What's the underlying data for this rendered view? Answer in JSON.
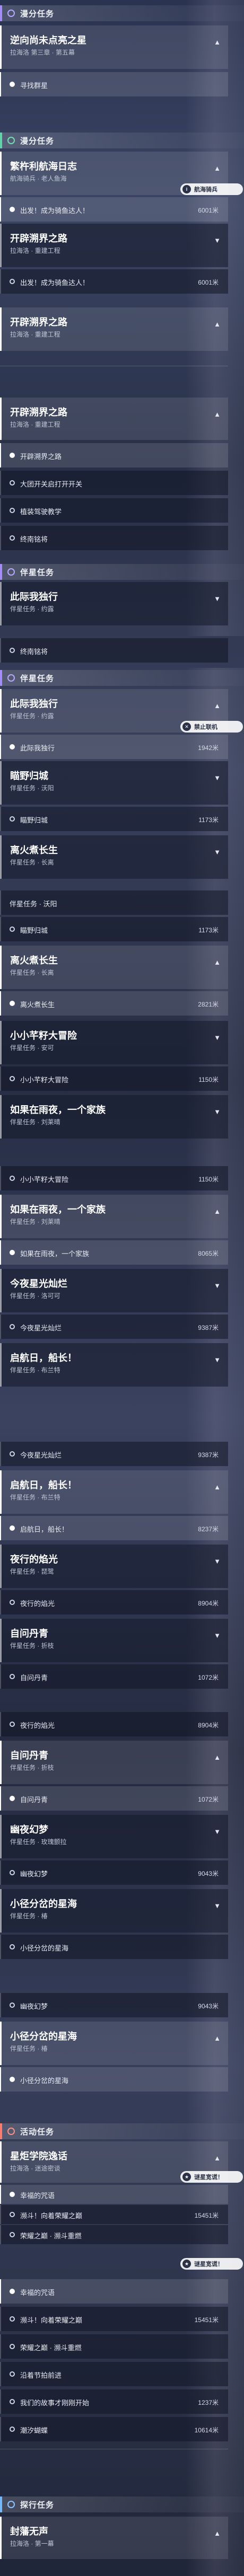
{
  "s1": {
    "cat_title": "漫分任务",
    "card_title": "逆向尚未点亮之星",
    "card_sub": "拉海洛 第三章 · 第五幕",
    "step_label": "寻找群星"
  },
  "s2": {
    "cat_title": "漫分任务",
    "card1_title": "繁杵利航海日志",
    "card1_sub": "航海骑兵 · 老人鱼海",
    "tooltip": "航海骑兵",
    "step1_label": "出发！成为骑鱼达人！",
    "step1_dist": "6001米",
    "card2_title": "开辟溯界之路",
    "card2_sub": "拉海洛 · 重建工程",
    "step2_label": "出发！成为骑鱼达人！",
    "step2_dist": "6001米",
    "card3_title": "开辟溯界之路",
    "card3_sub": "拉海洛 · 重建工程"
  },
  "s3": {
    "card_title": "开辟溯界之路",
    "card_sub": "拉海洛 · 重建工程",
    "step1_label": "开辟溯界之路",
    "step2_label": "大团开关启打开开关",
    "step3_label": "植装驾驶教学",
    "step4_label": "终南铭将"
  },
  "s4": {
    "cat_title": "伴星任务",
    "card_title": "此际我独行",
    "card_sub": "伴星任务 · 约露",
    "step_label": "终南铭将"
  },
  "s5": {
    "cat_title": "伴星任务",
    "card1_title": "此际我独行",
    "card1_sub": "伴星任务 · 约露",
    "tooltip": "禁止联机",
    "step1_label": "此际我独行",
    "step1_dist": "1942米",
    "card2_title": "瞄野归城",
    "card2_sub": "伴星任务 · 沃阳",
    "step2_label": "瞄野归城",
    "step2_dist": "1173米",
    "card3_title": "离火煮长生",
    "card3_sub": "伴星任务 · 长离"
  },
  "s6": {
    "step_label": "伴星任务 · 沃阳",
    "step1_label": "瞄野归城",
    "step1_dist": "1173米",
    "card_title": "离火煮长生",
    "card_sub": "伴星任务 · 长离",
    "step2_label": "离火煮长生",
    "step2_dist": "2821米",
    "card2_title": "小小芊籽大冒险",
    "card2_sub": "伴星任务 · 安可",
    "step3_label": "小小芊籽大冒险",
    "step3_dist": "1150米",
    "card3_title": "如果在雨夜，一个家族",
    "card3_sub": "伴星任务 · 刘莱晴"
  },
  "s7": {
    "step0_label": "小小芊籽大冒险",
    "step0_dist": "1150米",
    "card_title": "如果在雨夜，一个家族",
    "card_sub": "伴星任务 · 刘莱晴",
    "step1_label": "如果在雨夜，一个家族",
    "step1_dist": "8065米",
    "card2_title": "今夜星光灿烂",
    "card2_sub": "伴星任务 · 洛可可",
    "step2_label": "今夜星光灿烂",
    "step2_dist": "9387米",
    "card3_title": "启航日，船长！",
    "card3_sub": "伴星任务 · 布兰特"
  },
  "s8": {
    "step0_label": "今夜星光灿烂",
    "step0_dist": "9387米",
    "card_title": "启航日，船长！",
    "card_sub": "伴星任务 · 布兰特",
    "step1_label": "启航日，船长！",
    "step1_dist": "8237米",
    "card2_title": "夜行的焰光",
    "card2_sub": "伴星任务 · 琵鹭",
    "step2_label": "夜行的焰光",
    "step2_dist": "8904米",
    "card3_title": "自问丹青",
    "card3_sub": "伴星任务 · 折枝",
    "step3_label": "自问丹青",
    "step3_dist": "1072米"
  },
  "s9": {
    "step0_label": "夜行的焰光",
    "step0_dist": "8904米",
    "card_title": "自问丹青",
    "card_sub": "伴星任务 · 折枝",
    "step1_label": "自问丹青",
    "step1_dist": "1072米",
    "card2_title": "幽夜幻梦",
    "card2_sub": "伴星任务 · 玫瑰颤拉",
    "step2_label": "幽夜幻梦",
    "step2_dist": "9043米",
    "card3_title": "小径分岔的星海",
    "card3_sub": "伴星任务 · 椿",
    "step3_label": "小径分岔的星海"
  },
  "s10": {
    "step0_label": "幽夜幻梦",
    "step0_dist": "9043米",
    "card_title": "小径分岔的星海",
    "card_sub": "伴星任务 · 椿",
    "step1_label": "小径分岔的星海"
  },
  "s11": {
    "cat_title": "活动任务",
    "card_title": "星炬学院逸话",
    "card_sub": "拉海洛 · 迷途密谈",
    "tooltip": "谜星宽谎！",
    "step1_label": "幸福的咒语",
    "step2_label": "濒斗！向着荣耀之巅",
    "step2_dist": "15451米",
    "step3_label": "荣耀之巅 · 濒斗重燃"
  },
  "s12": {
    "tooltip": "谜星宽谎！",
    "step1_label": "幸福的咒语",
    "step2_label": "濒斗！向着荣耀之巅",
    "step2_dist": "15451米",
    "step3_label": "荣耀之巅 · 濒斗重燃",
    "step4_label": "沿着节拍前进",
    "step5_label": "我们的故事才刚刚开始",
    "step5_dist": "1237米",
    "step6_label": "潮汐蝴蝶",
    "step6_dist": "10614米"
  },
  "s13": {
    "cat_title": "探行任务",
    "card_title": "封藩无声",
    "card_sub": "拉海洛 · 第一幕"
  }
}
